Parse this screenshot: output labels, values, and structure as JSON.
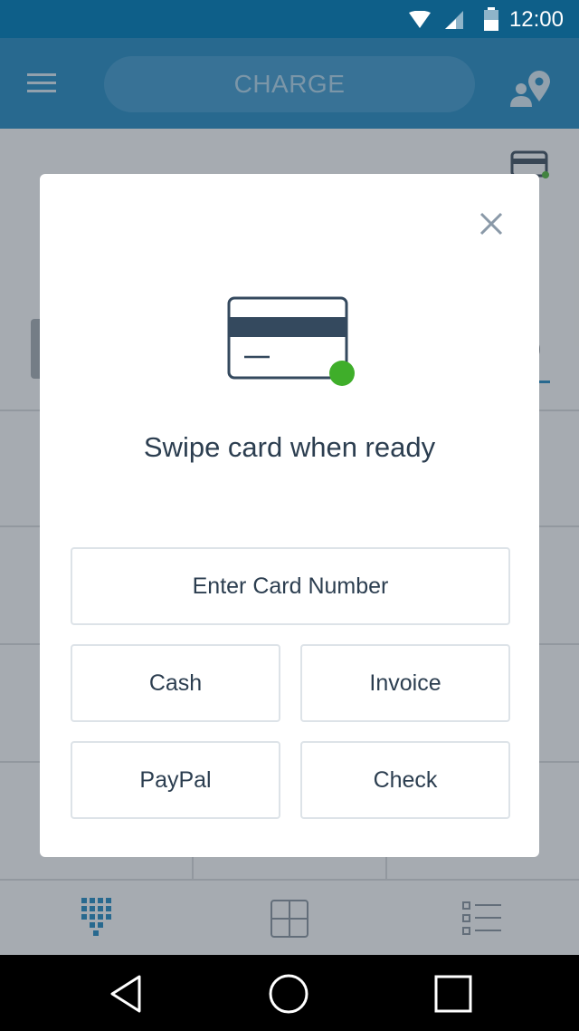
{
  "status_bar": {
    "time": "12:00"
  },
  "app_bar": {
    "charge_label": "CHARGE"
  },
  "background": {
    "amount_fragment": "0"
  },
  "dialog": {
    "title": "Swipe card when ready",
    "buttons": {
      "enter_card": "Enter Card Number",
      "cash": "Cash",
      "invoice": "Invoice",
      "paypal": "PayPal",
      "check": "Check"
    }
  },
  "icons": [
    "wifi-icon",
    "signal-icon",
    "battery-icon",
    "menu-icon",
    "customer-location-icon",
    "card-reader-icon",
    "close-icon",
    "credit-card-icon",
    "keypad-icon",
    "calculator-icon",
    "list-icon",
    "back-icon",
    "home-icon",
    "recents-icon"
  ],
  "colors": {
    "brand": "#0f7fba",
    "status_bar": "#0e5f89",
    "reader_ready": "#3fae2a",
    "text": "#2c3e50"
  }
}
